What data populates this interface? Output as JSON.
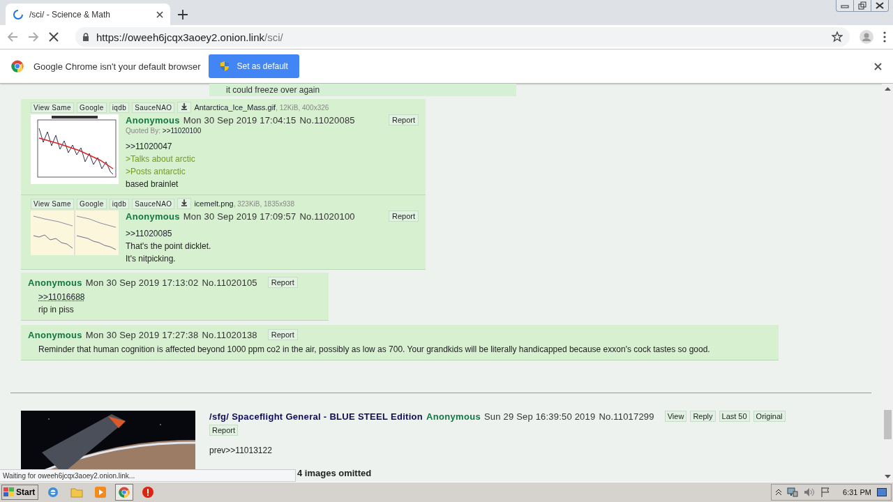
{
  "browser": {
    "tab": {
      "title": "/sci/ - Science & Math",
      "loading": true
    },
    "url": {
      "host": "https://oweeh6jcqx3aoey2.onion.link",
      "path": "/sci/"
    },
    "infobar": {
      "message": "Google Chrome isn't your default browser",
      "button": "Set as default"
    }
  },
  "partial_post": {
    "text": "it could freeze over again"
  },
  "posts": [
    {
      "file_buttons": [
        "View Same",
        "Google",
        "iqdb",
        "SauceNAO"
      ],
      "filename": "Antarctica_Ice_Mass.gif",
      "filesize": ", 12KiB, 400x326",
      "name": "Anonymous",
      "date": "Mon 30 Sep 2019 17:04:15",
      "number": "No.11020085",
      "report": "Report",
      "quoted_by_label": "Quoted By:",
      "quoted_by": ">>11020100",
      "body": [
        {
          "kind": "link",
          "text": ">>11020047"
        },
        {
          "kind": "quote",
          "text": ">Talks about arctic"
        },
        {
          "kind": "quote",
          "text": ">Posts antarctic"
        },
        {
          "kind": "text",
          "text": "based brainlet"
        }
      ]
    },
    {
      "file_buttons": [
        "View Same",
        "Google",
        "iqdb",
        "SauceNAO"
      ],
      "filename": "icemelt.png",
      "filesize": ", 323KiB, 1835x938",
      "name": "Anonymous",
      "date": "Mon 30 Sep 2019 17:09:57",
      "number": "No.11020100",
      "report": "Report",
      "body": [
        {
          "kind": "link",
          "text": ">>11020085"
        },
        {
          "kind": "text",
          "text": "That's the point dicklet."
        },
        {
          "kind": "text",
          "text": "It's nitpicking."
        }
      ]
    },
    {
      "kind": "text",
      "name": "Anonymous",
      "date": "Mon 30 Sep 2019 17:13:02",
      "number": "No.11020105",
      "report": "Report",
      "body": [
        {
          "kind": "deadlink",
          "text": ">>11016688"
        },
        {
          "kind": "text",
          "text": "rip in piss"
        }
      ]
    },
    {
      "kind": "wide",
      "name": "Anonymous",
      "date": "Mon 30 Sep 2019 17:27:38",
      "number": "No.11020138",
      "report": "Report",
      "body": [
        {
          "kind": "text",
          "text": "Reminder that human cognition is affected beyond 1000 ppm co2 in the air, possibly as low as 700. Your grandkids will be literally handicapped because exxon's cock tastes so good."
        }
      ]
    }
  ],
  "thread": {
    "subject": "/sfg/ Spaceflight General - BLUE STEEL Edition",
    "name": "Anonymous",
    "date": "Sun 29 Sep 16:39:50 2019",
    "number": "No.11017299",
    "buttons": [
      "View",
      "Reply",
      "Last 50",
      "Original",
      "Report"
    ],
    "body": "prev>>11013122",
    "omitted": "4 images omitted"
  },
  "status_bubble": "Waiting for oweeh6jcqx3aoey2.onion.link...",
  "taskbar": {
    "start": "Start",
    "time": "6:31 PM",
    "apps": [
      {
        "kind": "ie",
        "selected": false
      },
      {
        "kind": "folder",
        "selected": false
      },
      {
        "kind": "media",
        "selected": false
      },
      {
        "kind": "chrome",
        "selected": true
      },
      {
        "kind": "stop",
        "selected": false
      }
    ]
  }
}
